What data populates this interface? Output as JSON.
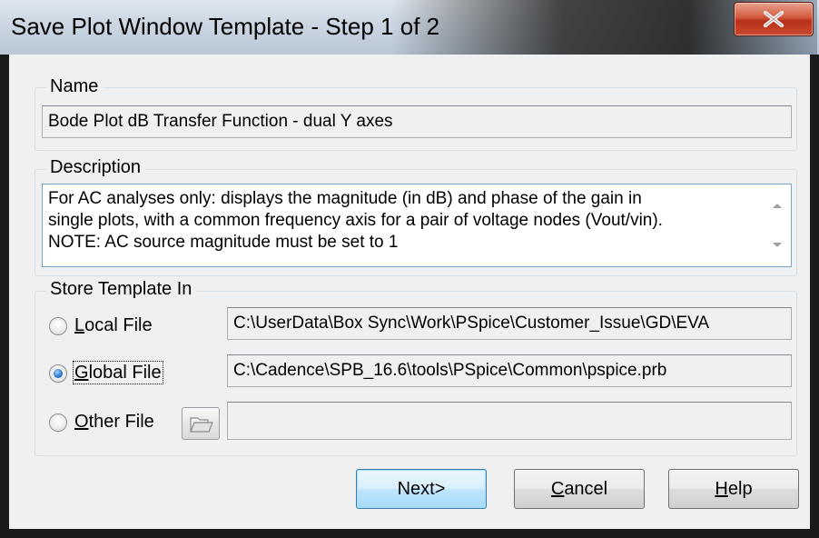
{
  "window": {
    "title": "Save Plot Window Template - Step 1 of 2",
    "close_icon": "close-x-icon"
  },
  "name_group": {
    "legend": "Name",
    "value": "Bode Plot dB Transfer Function - dual Y axes"
  },
  "description_group": {
    "legend": "Description",
    "lines": [
      "For AC analyses only: displays the magnitude (in dB) and phase of the gain in",
      "single plots, with a common frequency axis for a pair of voltage nodes (Vout/vin).",
      "NOTE: AC source magnitude must be set to 1"
    ]
  },
  "store_group": {
    "legend": "Store Template In",
    "options": [
      {
        "label_first": "L",
        "label_rest": "ocal File",
        "path": "C:\\UserData\\Box Sync\\Work\\PSpice\\Customer_Issue\\GD\\EVA",
        "selected": false
      },
      {
        "label_first": "G",
        "label_rest": "lobal File",
        "path": "C:\\Cadence\\SPB_16.6\\tools\\PSpice\\Common\\pspice.prb",
        "selected": true
      },
      {
        "label_first": "O",
        "label_rest": "ther File",
        "path": "",
        "selected": false
      }
    ],
    "browse_icon": "open-folder-icon"
  },
  "buttons": {
    "next": "Next>",
    "cancel_first": "C",
    "cancel_rest": "ancel",
    "help_first": "H",
    "help_rest": "elp"
  },
  "colors": {
    "accent": "#3c7fb1",
    "close_red": "#c84a2e",
    "dialog_bg": "#f0f0f0"
  }
}
